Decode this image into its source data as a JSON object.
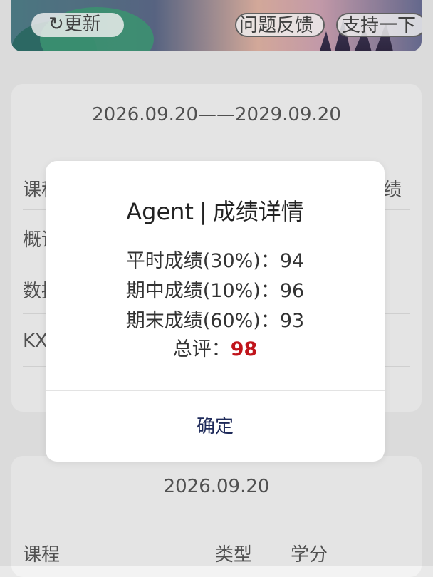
{
  "header": {
    "refresh_icon": "refresh-icon",
    "refresh_label": "更新",
    "feedback_label": "问题反馈",
    "support_label": "支持一下"
  },
  "card1": {
    "date_range": "2026.09.20——2029.09.20",
    "rows": [
      {
        "label": "课程",
        "right": "成绩"
      },
      {
        "label": "概论"
      },
      {
        "label": "数据"
      },
      {
        "label": "KX"
      }
    ]
  },
  "card2": {
    "date": "2026.09.20",
    "headers": {
      "course": "课程",
      "type": "类型",
      "credit": "学分"
    }
  },
  "dialog": {
    "title_main": "Agent",
    "title_sep": "|",
    "title_sub": "成绩详情",
    "lines": [
      {
        "label": "平时成绩(30%)：",
        "value": "94"
      },
      {
        "label": "期中成绩(10%)：",
        "value": "96"
      },
      {
        "label": "期末成绩(60%)：",
        "value": "93"
      }
    ],
    "total_label": "总评：",
    "total_value": "98",
    "confirm_label": "确定"
  },
  "colors": {
    "total_value": "#c0141b",
    "confirm_text": "#1e2a5a"
  }
}
